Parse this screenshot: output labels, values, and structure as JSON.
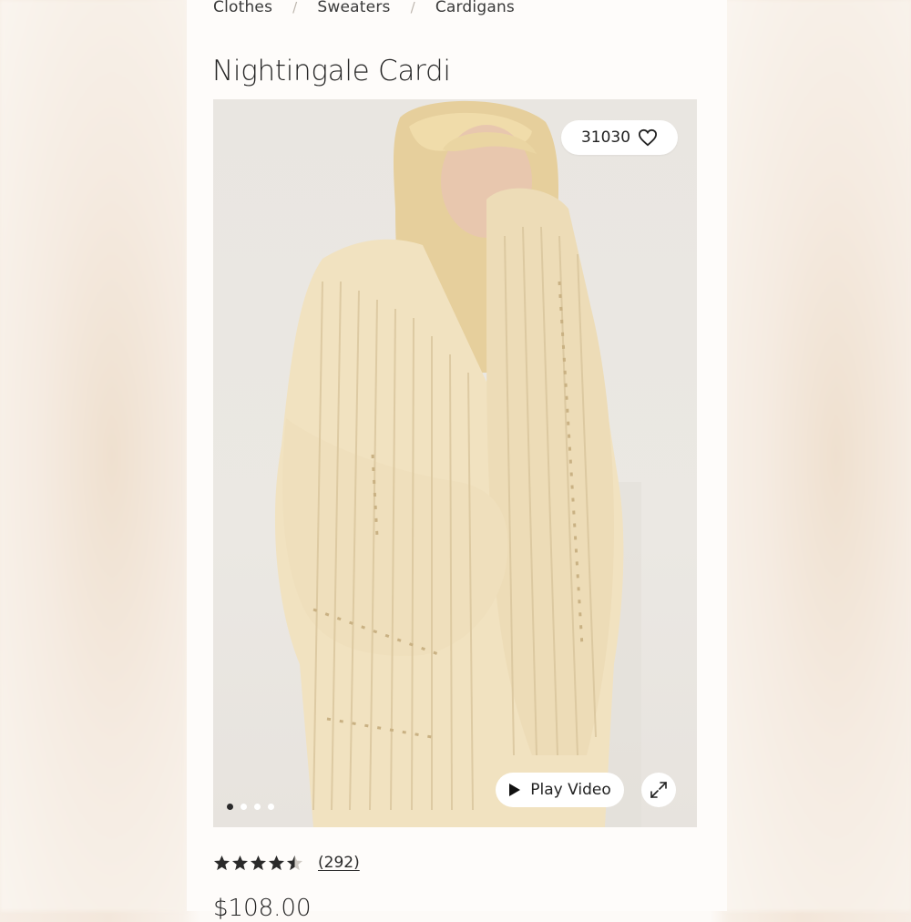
{
  "breadcrumb": [
    "Clothes",
    "Sweaters",
    "Cardigans"
  ],
  "breadcrumb_separator": "/",
  "product": {
    "title": "Nightingale Cardi",
    "favorite_count": "31030",
    "price": "$108.00",
    "rating": {
      "stars": 4.5,
      "out_of": 5,
      "review_count": "(292)"
    }
  },
  "media": {
    "play_label": "Play Video",
    "slides": 4,
    "active_slide": 1
  },
  "icons": {
    "favorite": "heart-icon",
    "play": "play-icon",
    "expand": "expand-icon",
    "star": "star-icon"
  },
  "colors": {
    "star": "#2a2a2a",
    "sweater": "#f1e2c0"
  }
}
